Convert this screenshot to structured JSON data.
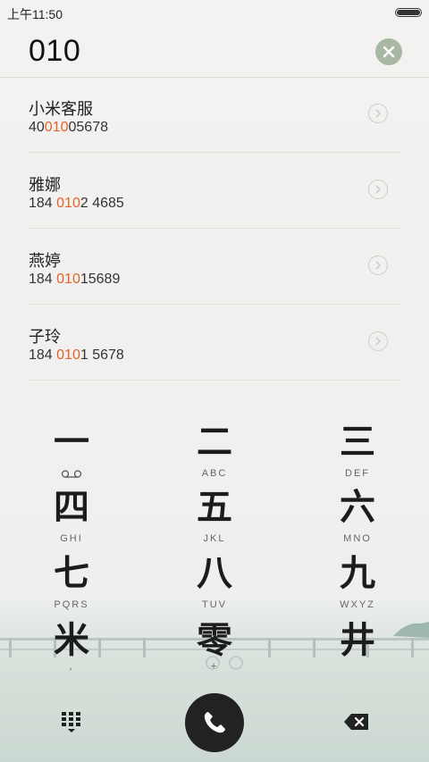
{
  "status": {
    "time": "上午11:50"
  },
  "search": {
    "value": "010"
  },
  "results": [
    {
      "name": "小米客服",
      "num_pre": "40",
      "num_hl": "010",
      "num_post": "05678"
    },
    {
      "name": "雅娜",
      "num_pre": "184 ",
      "num_hl": "010",
      "num_post": "2 4685"
    },
    {
      "name": "燕婷",
      "num_pre": "184 ",
      "num_hl": "010",
      "num_post": "15689"
    },
    {
      "name": "子玲",
      "num_pre": "184 ",
      "num_hl": "010",
      "num_post": "1 5678"
    }
  ],
  "keypad": {
    "k1": {
      "glyph": "一",
      "sub": ""
    },
    "k2": {
      "glyph": "二",
      "sub": "ABC"
    },
    "k3": {
      "glyph": "三",
      "sub": "DEF"
    },
    "k4": {
      "glyph": "四",
      "sub": "GHI"
    },
    "k5": {
      "glyph": "五",
      "sub": "JKL"
    },
    "k6": {
      "glyph": "六",
      "sub": "MNO"
    },
    "k7": {
      "glyph": "七",
      "sub": "PQRS"
    },
    "k8": {
      "glyph": "八",
      "sub": "TUV"
    },
    "k9": {
      "glyph": "九",
      "sub": "WXYZ"
    },
    "kstar": {
      "glyph": "米",
      "sub": ","
    },
    "k0": {
      "glyph": "零",
      "sub": "+"
    },
    "khash": {
      "glyph": "井",
      "sub": ""
    }
  },
  "colors": {
    "highlight": "#e5622a",
    "clear_button": "#a9b7a5",
    "call_button": "#222222"
  },
  "icons": {
    "clear": "close-icon",
    "row": "chevron-right-icon",
    "voicemail": "voicemail-icon",
    "call": "phone-icon",
    "dialpad": "dialpad-icon",
    "backspace": "backspace-icon"
  }
}
